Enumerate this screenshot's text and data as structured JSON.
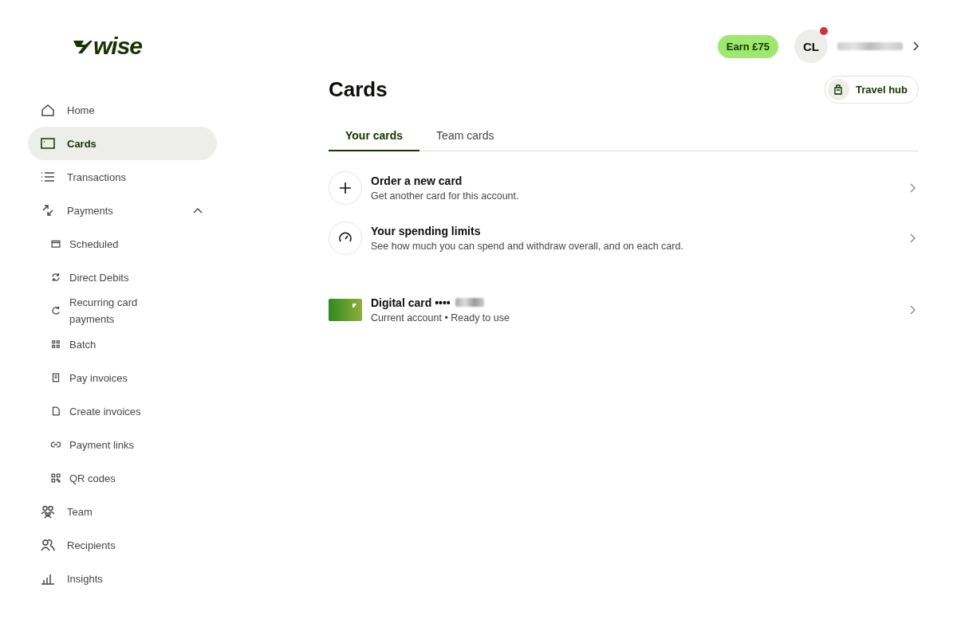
{
  "header": {
    "logo": "wise",
    "promo": "Earn £75",
    "avatar": {
      "initials": "CL",
      "notification": true
    }
  },
  "sidebar": {
    "items": [
      {
        "label": "Home",
        "selected": false
      },
      {
        "label": "Cards",
        "selected": true
      },
      {
        "label": "Transactions",
        "selected": false
      },
      {
        "label": "Payments",
        "selected": false,
        "expanded": true,
        "children": [
          {
            "label": "Scheduled",
            "selected": false
          },
          {
            "label": "Direct Debits",
            "selected": false
          },
          {
            "label": "Recurring card payments",
            "selected": false
          },
          {
            "label": "Batch",
            "selected": false
          },
          {
            "label": "Pay invoices",
            "selected": false
          },
          {
            "label": "Create invoices",
            "selected": false
          },
          {
            "label": "Payment links",
            "selected": false
          },
          {
            "label": "QR codes",
            "selected": false
          }
        ]
      },
      {
        "label": "Team",
        "selected": false
      },
      {
        "label": "Recipients",
        "selected": false
      },
      {
        "label": "Insights",
        "selected": false
      }
    ]
  },
  "page": {
    "title": "Cards",
    "action": "Travel hub",
    "tabs": [
      {
        "label": "Your cards",
        "selected": true
      },
      {
        "label": "Team cards",
        "selected": false
      }
    ],
    "actions": [
      {
        "title": "Order a new card",
        "subtitle": "Get another card for this account."
      },
      {
        "title": "Your spending limits",
        "subtitle": "See how much you can spend and withdraw overall, and on each card."
      }
    ],
    "cards": [
      {
        "title": "Digital card ••••",
        "subtitle": "Current account • Ready to use"
      }
    ]
  }
}
